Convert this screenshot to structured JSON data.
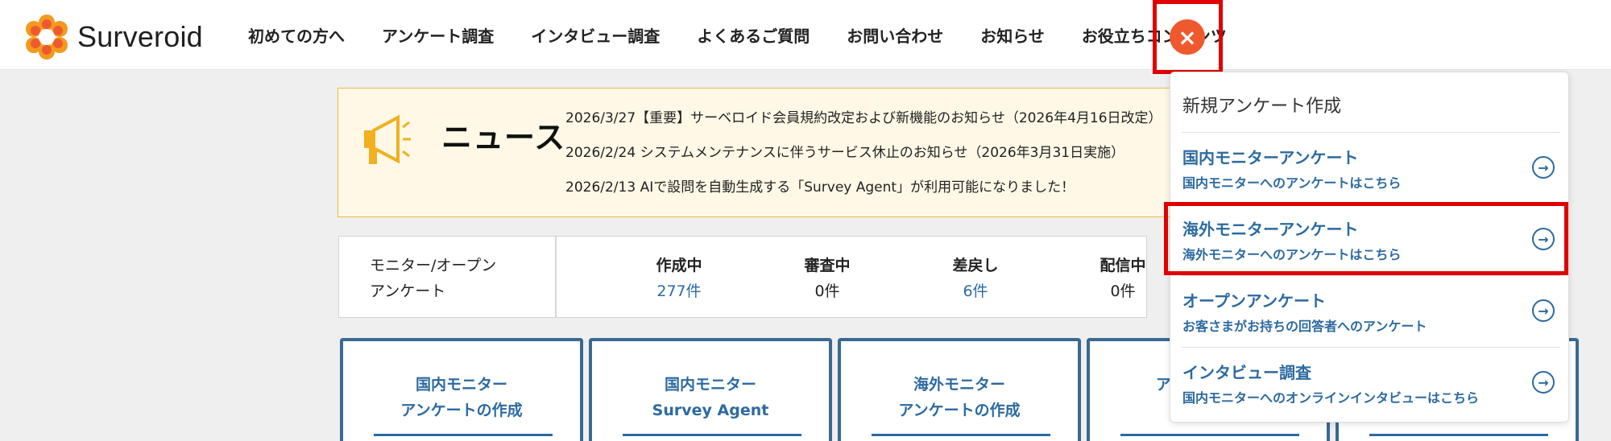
{
  "brand": {
    "name": "Surveroid",
    "accent": "#ee5a2d",
    "link": "#2c6aa0"
  },
  "nav": {
    "items": [
      "初めての方へ",
      "アンケート調査",
      "インタビュー調査",
      "よくあるご質問",
      "お問い合わせ",
      "お知らせ",
      "お役立ちコンテンツ"
    ],
    "close_icon": "×"
  },
  "news": {
    "title": "ニュース",
    "items": [
      "2026/3/27【重要】サーベロイド会員規約改定および新機能のお知らせ（2026年4月16日改定）",
      "2026/2/24 システムメンテナンスに伴うサービス休止のお知らせ（2026年3月31日実施）",
      "2026/2/13 AIで設問を自動生成する「Survey Agent」が利用可能になりました！"
    ]
  },
  "stats": {
    "label_line1": "モニター/オープン",
    "label_line2": "アンケート",
    "items": [
      {
        "label": "作成中",
        "value": "277件"
      },
      {
        "label": "審査中",
        "value": "0件"
      },
      {
        "label": "差戻し",
        "value": "6件"
      },
      {
        "label": "配信中",
        "value": "0件"
      }
    ]
  },
  "cards": [
    {
      "line1": "国内モニター",
      "line2": "アンケートの作成"
    },
    {
      "line1": "国内モニター",
      "line2": "Survey Agent"
    },
    {
      "line1": "海外モニター",
      "line2": "アンケートの作成"
    },
    {
      "line1": "",
      "line2": "ア"
    }
  ],
  "dropdown": {
    "heading": "新規アンケート作成",
    "items": [
      {
        "title": "国内モニターアンケート",
        "sub": "国内モニターへのアンケートはこちら"
      },
      {
        "title": "海外モニターアンケート",
        "sub": "海外モニターへのアンケートはこちら"
      },
      {
        "title": "オープンアンケート",
        "sub": "お客さまがお持ちの回答者へのアンケート"
      },
      {
        "title": "インタビュー調査",
        "sub": "国内モニターへのオンラインインタビューはこちら"
      }
    ],
    "arrow_icon": "→"
  }
}
